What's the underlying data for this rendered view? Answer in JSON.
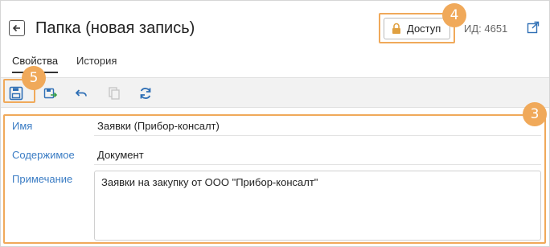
{
  "header": {
    "title": "Папка (новая запись)",
    "access_button": "Доступ",
    "id_label": "ИД: 4651"
  },
  "tabs": [
    {
      "label": "Свойства",
      "active": true
    },
    {
      "label": "История",
      "active": false
    }
  ],
  "toolbar": {
    "buttons": [
      "save-icon",
      "save-and-close-icon",
      "undo-icon",
      "copy-icon",
      "refresh-icon"
    ]
  },
  "form": {
    "name": {
      "label": "Имя",
      "value": "Заявки (Прибор-консалт)"
    },
    "content": {
      "label": "Содержимое",
      "value": "Документ"
    },
    "note": {
      "label": "Примечание",
      "value": "Заявки на закупку от ООО \"Прибор-консалт\""
    }
  },
  "annotations": {
    "badge_3": "3",
    "badge_4": "4",
    "badge_5": "5"
  },
  "colors": {
    "accent": "#f0a95a",
    "label_blue": "#3a7cc4",
    "icon_blue": "#2f6fb5"
  }
}
